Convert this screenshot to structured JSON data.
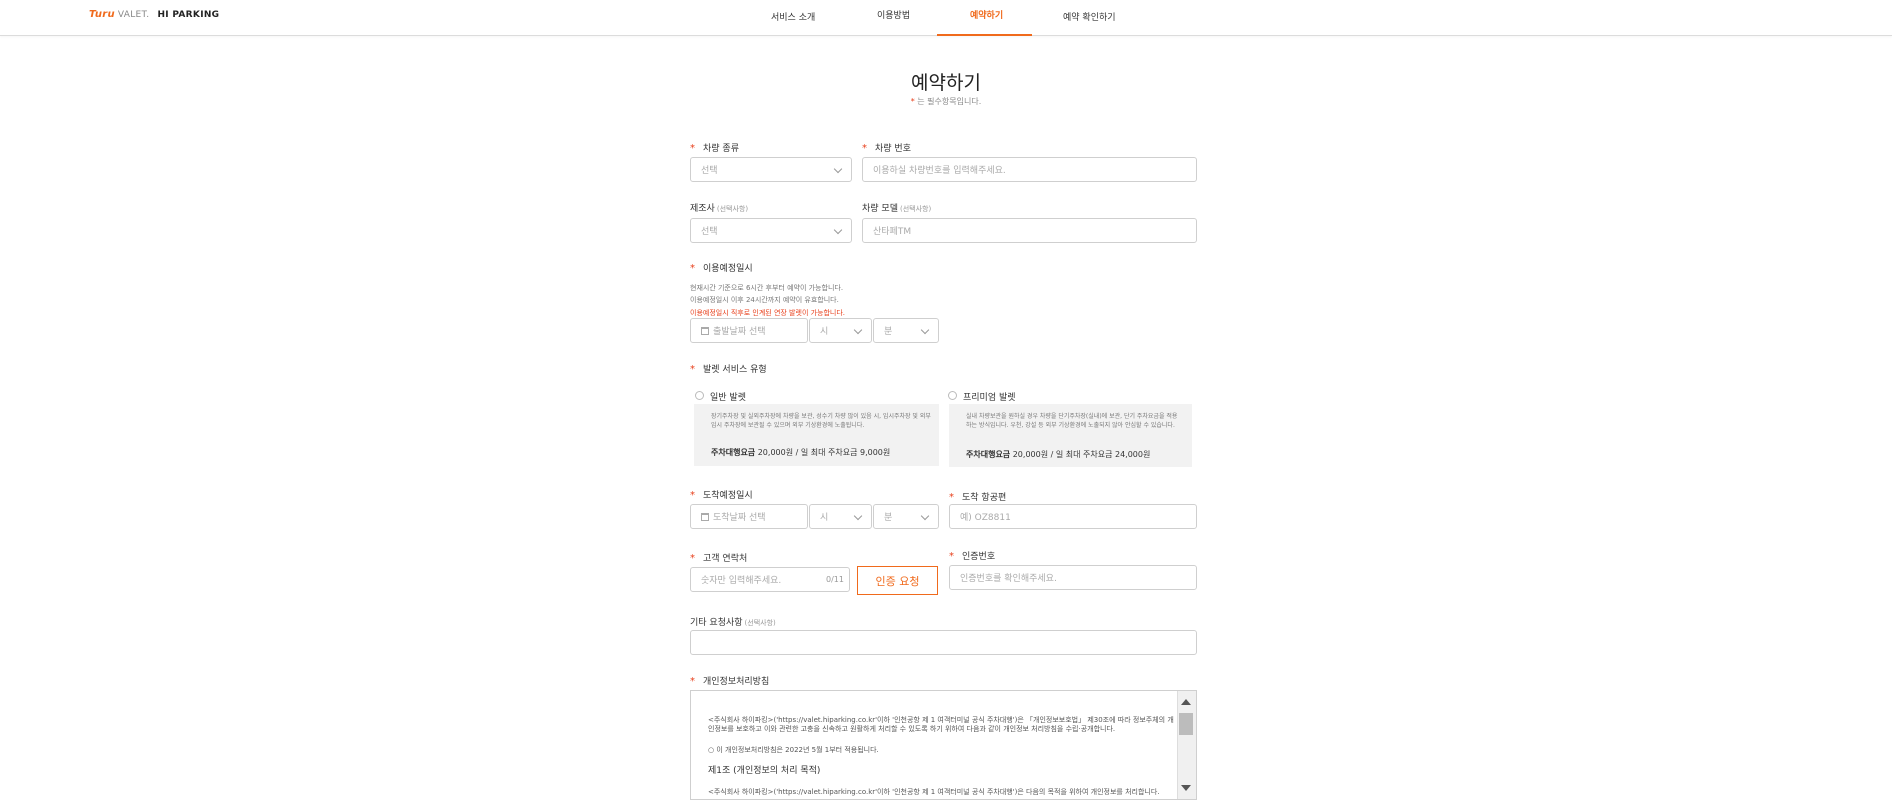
{
  "header": {
    "logo_brand": "Turu",
    "logo_valet": "VALET.",
    "logo_hiparking": "HI PARKING",
    "nav": [
      "서비스 소개",
      "이용방법",
      "예약하기",
      "예약 확인하기"
    ],
    "active_nav": "예약하기"
  },
  "page": {
    "title": "예약하기",
    "required_note_star": "*",
    "required_note": " 는 필수항목입니다."
  },
  "form": {
    "required_star": "*",
    "vehicle_type": {
      "label": "차량 종류",
      "value": "선택"
    },
    "vehicle_number": {
      "label": "차량 번호",
      "placeholder": "이용하실 차량번호를 입력해주세요."
    },
    "manufacturer": {
      "label": "제조사",
      "optional": "(선택사항)",
      "value": "선택"
    },
    "model": {
      "label": "차량 모델",
      "optional": "(선택사항)",
      "placeholder": "산타페TM"
    },
    "departure": {
      "label": "이용예정일시",
      "help_1": "현재시간 기준으로 6시간 후부터 예약이 가능합니다.",
      "help_2": "이용예정일시 이후 24시간까지 예약이 유효합니다.",
      "help_warn": "이용예정일시 직후로 인계된 연장 발렛이 가능합니다.",
      "date_placeholder": "출발날짜 선택",
      "hour": "시",
      "minute": "분"
    },
    "service": {
      "label": "발렛 서비스 유형",
      "options": [
        {
          "name": "일반 발렛",
          "desc": "장기주차장 및 실외주차장에 차량을 보관, 성수기 차량 많이 있음 시, 임시주차장 및 외부임시 주차장에 보관될 수 있으며 외부 기상환경에 노출됩니다.",
          "price_label": "주차대행요금",
          "price": " 20,000원 / 일 최대 주차요금 9,000원"
        },
        {
          "name": "프리미엄 발렛",
          "desc": "실내 차량보관을 원하실 경우 차량을 단기주차장(실내)에 보관, 단기 주차요금을 적용하는 방식입니다. 우천, 강설 등 외부 기상환경에 노출되지 않아 안심할 수 있습니다.",
          "price_label": "주차대행요금",
          "price": " 20,000원 / 일 최대 주차요금 24,000원"
        }
      ]
    },
    "arrival": {
      "label": "도착예정일시",
      "date_placeholder": "도착날짜 선택",
      "hour": "시",
      "minute": "분"
    },
    "flight": {
      "label": "도착 항공편",
      "placeholder": "예) OZ8811"
    },
    "phone": {
      "label": "고객 연락처",
      "placeholder": "숫자만 입력해주세요.",
      "counter": "0/11",
      "auth_button": "인증 요청"
    },
    "auth_code": {
      "label": "인증번호",
      "placeholder": "인증번호를 확인해주세요."
    },
    "requests": {
      "label": "기타 요청사항",
      "optional": "(선택사항)"
    },
    "privacy": {
      "label": "개인정보처리방침",
      "para_1": "<주식회사 하이파킹>('https://valet.hiparking.co.kr'이하 '인천공항 제 1 여객터미널 공식 주차대행')은 「개인정보보호법」 제30조에 따라 정보주체의 개인정보를 보호하고 이와 관련한 고충을 신속하고 원활하게 처리할 수 있도록 하기 위하여 다음과 같이 개인정보 처리방침을 수립·공개합니다.",
      "para_2": "○ 이 개인정보처리방침은 2022년 5월 1부터 적용됩니다.",
      "heading_1": "제1조 (개인정보의 처리 목적)",
      "para_3": "<주식회사 하이파킹>('https://valet.hiparking.co.kr'이하 '인천공항 제 1 여객터미널 공식 주차대행')은 다음의 목적을 위하여 개인정보를 처리합니다."
    }
  },
  "colors": {
    "accent": "#f06a1c",
    "required": "#e8401c"
  }
}
